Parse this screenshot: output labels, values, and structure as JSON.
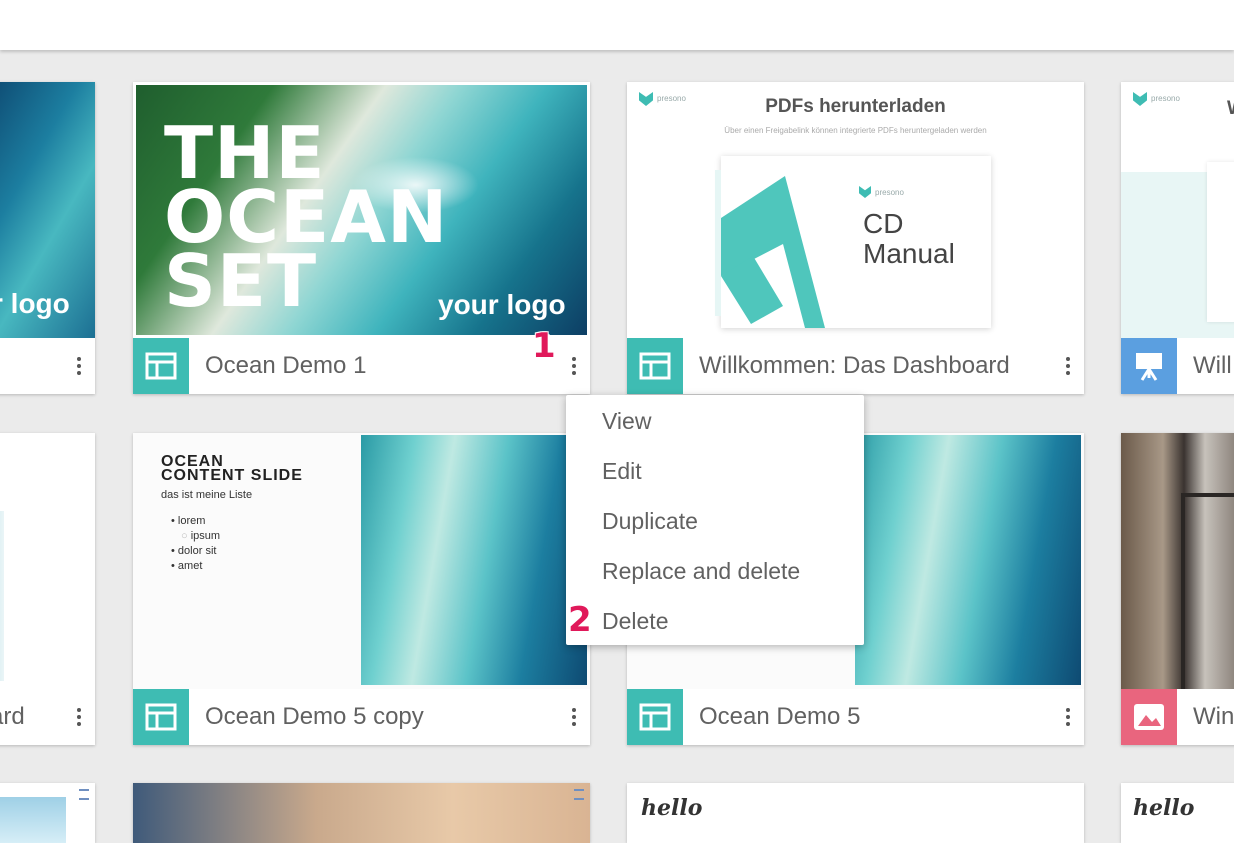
{
  "colors": {
    "teal": "#3ebcb3",
    "blue": "#5b9fe0",
    "pink": "#e9657e",
    "marker": "#e0195a"
  },
  "cards": {
    "left1": {
      "logo": "r logo",
      "icon": "layout-icon"
    },
    "left2": {
      "title": "ard",
      "icon": "layout-icon"
    },
    "ocean1": {
      "title": "Ocean Demo 1",
      "icon": "layout-icon",
      "thumb": {
        "line1": "THE",
        "line2": "OCEAN",
        "line3": "SET",
        "logo": "your logo"
      }
    },
    "willkommen": {
      "title": "Willkommen: Das Dashboard",
      "icon": "layout-icon",
      "thumb": {
        "brand": "presono",
        "heading": "PDFs herunterladen",
        "sub": "Über einen Freigabelink können integrierte PDFs heruntergeladen werden",
        "doc_brand": "presono",
        "doc_line1": "CD",
        "doc_line2": "Manual"
      }
    },
    "right1": {
      "title": "Will",
      "icon": "presentation-icon",
      "thumb": {
        "brand": "presono",
        "heading": "W"
      }
    },
    "ocean5copy": {
      "title": "Ocean Demo 5 copy",
      "icon": "layout-icon",
      "thumb": {
        "h1": "OCEAN",
        "h2": "CONTENT SLIDE",
        "sub": "das ist meine Liste",
        "bullets": [
          "lorem",
          "ipsum",
          "dolor sit",
          "amet"
        ]
      }
    },
    "ocean5": {
      "title": "Ocean Demo 5",
      "icon": "layout-icon"
    },
    "right2": {
      "title": "Win",
      "icon": "image-icon"
    },
    "row3": {
      "hello1": "hello",
      "hello2": "hello"
    }
  },
  "context_menu": {
    "items": [
      "View",
      "Edit",
      "Duplicate",
      "Replace and delete",
      "Delete"
    ]
  },
  "markers": {
    "m1": "1",
    "m2": "2"
  }
}
